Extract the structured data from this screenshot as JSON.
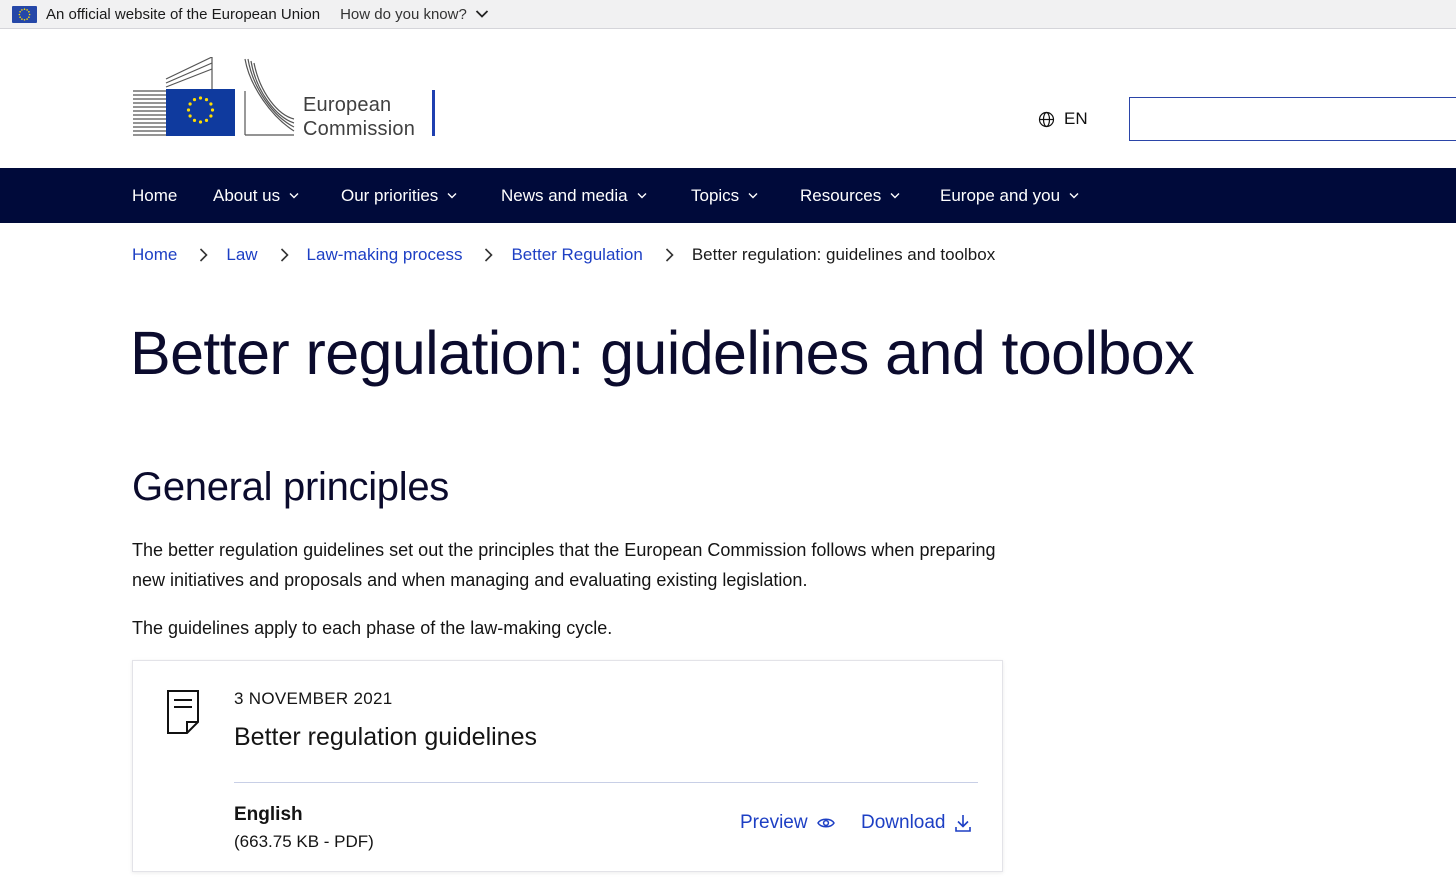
{
  "eu_bar": {
    "official_text": "An official website of the European Union",
    "how_text": "How do you know?"
  },
  "header": {
    "logo_line1": "European",
    "logo_line2": "Commission",
    "language": "EN",
    "search_value": ""
  },
  "nav": {
    "items": [
      {
        "label": "Home"
      },
      {
        "label": "About us"
      },
      {
        "label": "Our priorities"
      },
      {
        "label": "News and media"
      },
      {
        "label": "Topics"
      },
      {
        "label": "Resources"
      },
      {
        "label": "Europe and you"
      }
    ]
  },
  "breadcrumb": {
    "items": [
      "Home",
      "Law",
      "Law-making process",
      "Better Regulation"
    ],
    "current": "Better regulation: guidelines and toolbox"
  },
  "main": {
    "title": "Better regulation: guidelines and toolbox",
    "section_title": "General principles",
    "paragraph1": "The better regulation guidelines set out the principles that the European Commission follows when preparing new initiatives and proposals and when managing and evaluating existing legislation.",
    "paragraph2": "The guidelines apply to each phase of the law-making cycle."
  },
  "file_card": {
    "date": "3 NOVEMBER 2021",
    "title": "Better regulation guidelines",
    "language": "English",
    "meta": "(663.75 KB - PDF)",
    "preview_label": "Preview",
    "download_label": "Download"
  },
  "colors": {
    "nav_bg": "#000a3a",
    "link": "#1d3fc4",
    "eu_blue": "#2547a8",
    "eu_yellow": "#ffdd00"
  }
}
